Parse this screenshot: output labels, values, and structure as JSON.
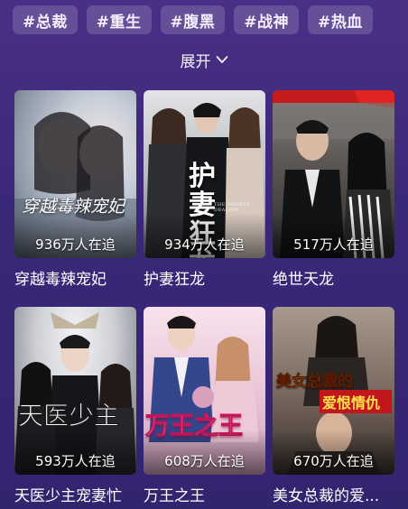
{
  "tags": [
    "#总裁",
    "#重生",
    "#腹黑",
    "#战神",
    "#热血"
  ],
  "expand_label": "展开",
  "dramas": [
    {
      "title": "穿越毒辣宠妃",
      "views": "936万人在追",
      "poster_text": "穿越毒辣宠妃",
      "palette": [
        "#cfd6e0",
        "#7f8a9c",
        "#3c4452"
      ]
    },
    {
      "title": "护妻狂龙",
      "views": "934万人在追",
      "poster_text": "护妻狂龙",
      "poster_subtext": "THE MIGHTY DRAGON",
      "palette": [
        "#d7d9dc",
        "#7a7f87",
        "#2a2d33"
      ]
    },
    {
      "title": "绝世天龙",
      "views": "517万人在追",
      "palette": [
        "#b9b5b2",
        "#5f5a58",
        "#1a1a1c"
      ]
    },
    {
      "title": "天医少主宠妻忙",
      "views": "593万人在追",
      "poster_text": "天医少主",
      "palette": [
        "#e6e6ea",
        "#8e8f98",
        "#2d2e34"
      ]
    },
    {
      "title": "万王之王",
      "views": "608万人在追",
      "poster_text": "万王之王",
      "palette": [
        "#f4d9e6",
        "#c99bbd",
        "#3b4f8f"
      ]
    },
    {
      "title": "美女总裁的爱...",
      "views": "670万人在追",
      "poster_text": "美女总裁的",
      "poster_subtext": "爱恨情仇",
      "palette": [
        "#b6a79a",
        "#6d5a4f",
        "#2b2422"
      ]
    }
  ]
}
